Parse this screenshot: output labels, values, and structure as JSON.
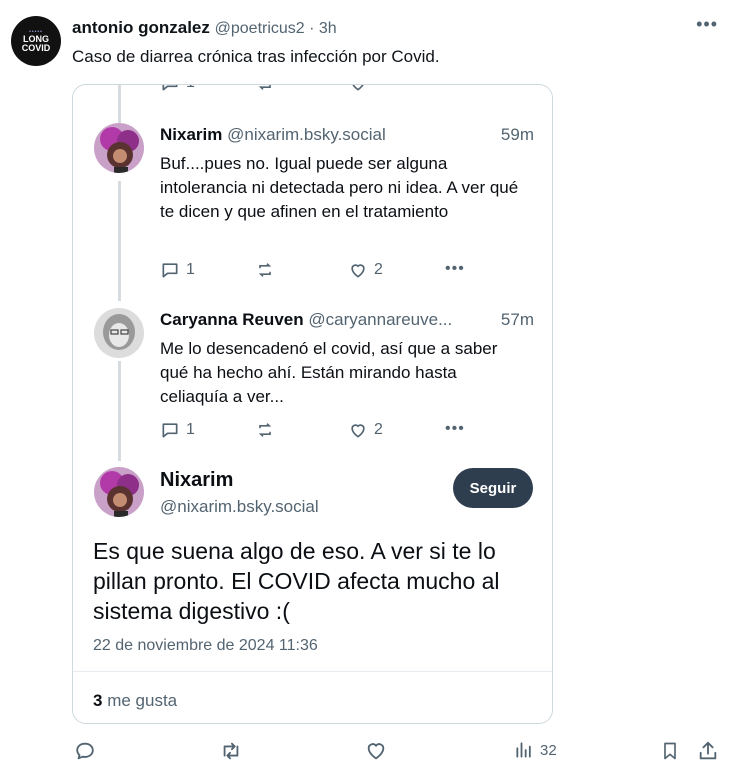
{
  "tweet": {
    "author_name": "antonio gonzalez",
    "author_handle": "@poetricus2",
    "separator": " · ",
    "time": "3h",
    "text": "Caso de diarrea crónica tras infección por Covid.",
    "avatar_text": [
      "LONG",
      "COVID"
    ],
    "views": "32"
  },
  "embed": {
    "top_partial_actions": {
      "replies": "1"
    },
    "replies": [
      {
        "name": "Nixarim",
        "handle": "@nixarim.bsky.social",
        "time": "59m",
        "text": "Buf....pues no. Igual puede ser alguna intolerancia ni detectada pero ni idea. A ver qué te dicen y que afinen en el tratamiento",
        "reply_count": "1",
        "like_count": "2"
      },
      {
        "name": "Caryanna Reuven",
        "handle": "@caryannareuve...",
        "time": "57m",
        "text": "Me lo desencadenó el covid, así que a saber qué ha hecho ahí. Están mirando hasta celiaquía a ver...",
        "reply_count": "1",
        "like_count": "2"
      }
    ],
    "main": {
      "name": "Nixarim",
      "handle": "@nixarim.bsky.social",
      "follow_label": "Seguir",
      "text": "Es que suena algo de eso. A ver si te lo pillan pronto. El COVID afecta mucho al sistema digestivo :(",
      "date": "22 de noviembre de 2024 11:36",
      "likes_count": "3",
      "likes_label": " me gusta"
    }
  },
  "icons": {
    "more": "more-icon",
    "reply": "reply-icon",
    "repost": "repost-icon",
    "like": "heart-icon",
    "views": "views-icon",
    "bookmark": "bookmark-icon",
    "share": "share-icon"
  },
  "colors": {
    "text_primary": "#0f1419",
    "text_secondary": "#536471",
    "follow_button": "#2e3e4e",
    "border": "#cfd9de"
  }
}
